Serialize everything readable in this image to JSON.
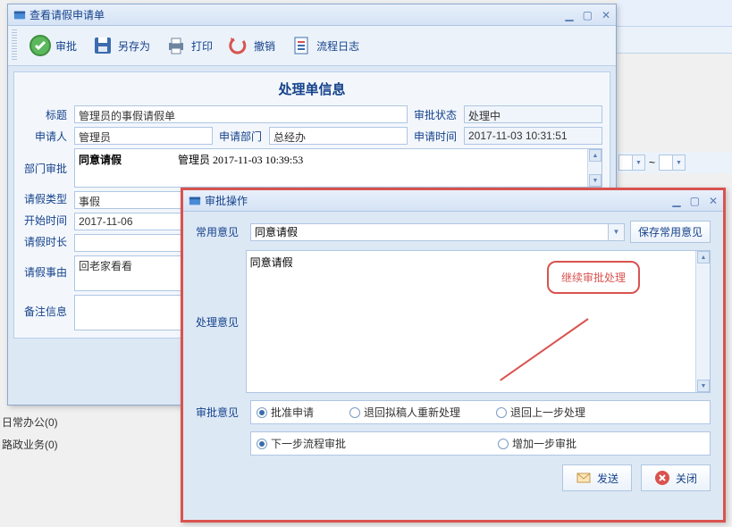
{
  "window1": {
    "title": "查看请假申请单",
    "toolbar": {
      "approve": "审批",
      "saveas": "另存为",
      "print": "打印",
      "undo": "撤销",
      "log": "流程日志"
    },
    "section_title": "处理单信息",
    "labels": {
      "title": "标题",
      "status": "审批状态",
      "applicant": "申请人",
      "dept": "申请部门",
      "apply_time": "申请时间",
      "dept_approve": "部门审批",
      "leave_type": "请假类型",
      "start_time": "开始时间",
      "leave_dur": "请假时长",
      "leave_reason": "请假事由",
      "remark": "备注信息"
    },
    "values": {
      "title": "管理员的事假请假单",
      "status": "处理中",
      "applicant": "管理员",
      "dept": "总经办",
      "apply_time": "2017-11-03 10:31:51",
      "dept_approve_line1": "同意请假",
      "dept_approve_line2": "管理员 2017-11-03 10:39:53",
      "leave_type": "事假",
      "start_time": "2017-11-06",
      "leave_dur": "",
      "leave_reason": "回老家看看",
      "remark": ""
    }
  },
  "window2": {
    "title": "审批操作",
    "labels": {
      "common_opinion": "常用意见",
      "save_common": "保存常用意见",
      "process_opinion": "处理意见",
      "approve_opinion": "审批意见"
    },
    "combo_value": "同意请假",
    "textarea_value": "同意请假",
    "radios1": [
      {
        "label": "批准申请",
        "checked": true
      },
      {
        "label": "退回拟稿人重新处理",
        "checked": false
      },
      {
        "label": "退回上一步处理",
        "checked": false
      }
    ],
    "radios2": [
      {
        "label": "下一步流程审批",
        "checked": true
      },
      {
        "label": "增加一步审批",
        "checked": false
      }
    ],
    "buttons": {
      "send": "发送",
      "close": "关闭"
    }
  },
  "callout": "继续审批处理",
  "sidelist": [
    "日常办公(0)",
    "路政业务(0)"
  ],
  "tilde": "~"
}
